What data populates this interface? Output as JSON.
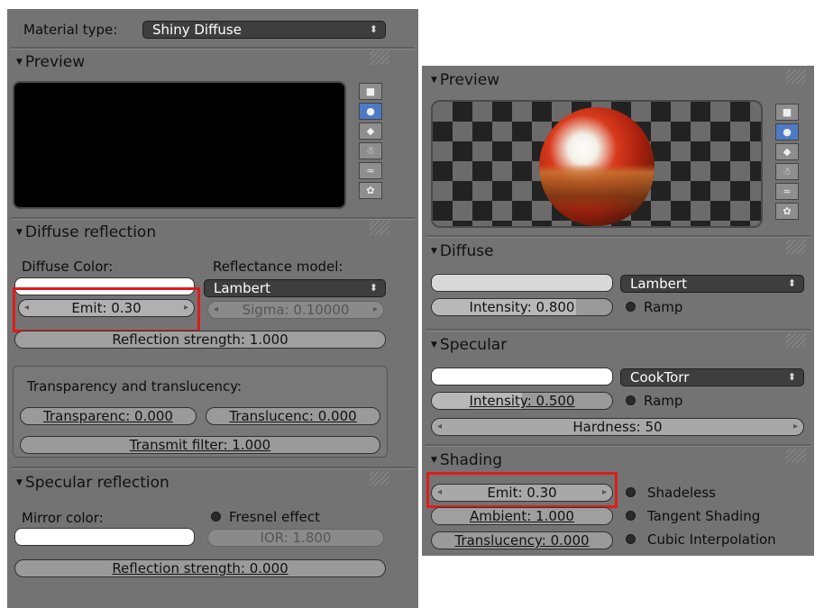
{
  "left": {
    "material_type_label": "Material type:",
    "material_type_value": "Shiny Diffuse",
    "preview_header": "Preview",
    "diffuse_header": "Diffuse reflection",
    "diffuse_color_label": "Diffuse Color:",
    "reflectance_model_label": "Reflectance model:",
    "reflectance_model_value": "Lambert",
    "emit": "Emit: 0.30",
    "sigma": "Sigma: 0.10000",
    "reflection_strength": "Reflection strength: 1.000",
    "transparency_group_label": "Transparency and translucency:",
    "transparency": "Transparenc: 0.000",
    "translucency": "Translucenc: 0.000",
    "transmit_filter": "Transmit filter: 1.000",
    "specular_header": "Specular reflection",
    "mirror_color_label": "Mirror color:",
    "fresnel_label": "Fresnel effect",
    "ior": "IOR: 1.800",
    "specular_reflection_strength": "Reflection strength: 0.000"
  },
  "right": {
    "preview_header": "Preview",
    "diffuse_header": "Diffuse",
    "diffuse_shader": "Lambert",
    "diffuse_intensity": "Intensity: 0.800",
    "diffuse_intensity_fraction": 0.8,
    "ramp_label": "Ramp",
    "specular_header": "Specular",
    "specular_shader": "CookTorr",
    "specular_intensity": "Intensity: 0.500",
    "specular_intensity_fraction": 0.5,
    "specular_ramp_label": "Ramp",
    "hardness": "Hardness: 50",
    "shading_header": "Shading",
    "emit": "Emit: 0.30",
    "ambient": "Ambient: 1.000",
    "translucency": "Translucency: 0.000",
    "shadeless_label": "Shadeless",
    "tangent_shading_label": "Tangent Shading",
    "cubic_interpolation_label": "Cubic Interpolation"
  },
  "preview_tools": [
    "flat-plane-icon",
    "sphere-icon",
    "cube-icon",
    "monkey-icon",
    "hair-icon",
    "sphere-monkey-icon"
  ],
  "colors": {
    "panel_bg": "#737373",
    "highlight_box": "#e11b1b",
    "active_tool": "#4e79c6",
    "swatch_white": "#ffffff"
  }
}
